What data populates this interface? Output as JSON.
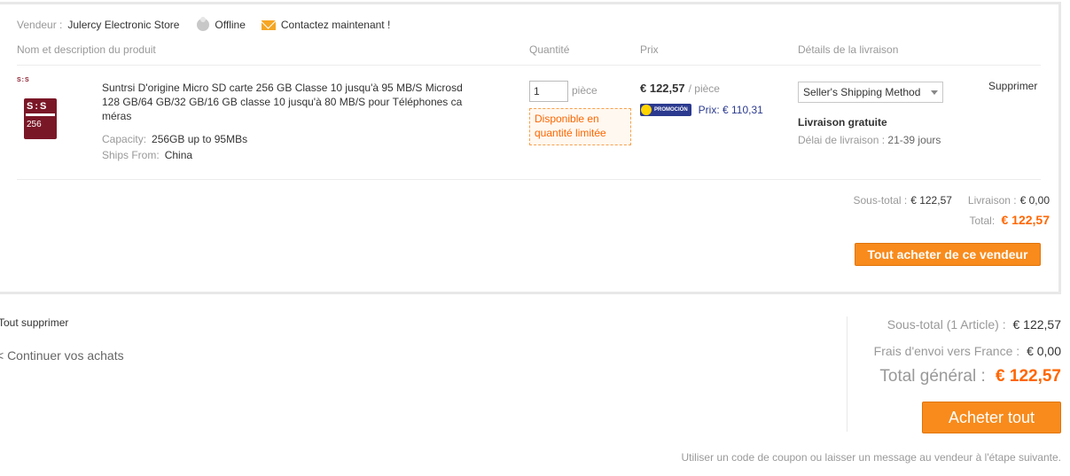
{
  "store": {
    "vendor_label": "Vendeur :",
    "vendor_name": "Julercy Electronic Store",
    "status": "Offline",
    "contact": "Contactez maintenant !"
  },
  "columns": {
    "product": "Nom et description du produit",
    "quantity": "Quantité",
    "price": "Prix",
    "shipping": "Détails de la livraison"
  },
  "item": {
    "thumb_brand": "S:S",
    "thumb_logo": "S:S",
    "thumb_capacity": "256",
    "title": "Suntrsi D'origine Micro SD carte 256 GB Classe 10 jusqu'à 95 MB/S Microsd 128 GB/64 GB/32 GB/16 GB classe 10 jusqu'à 80 MB/S pour Téléphones ca méras",
    "attributes": [
      {
        "label": "Capacity:",
        "value": "256GB up to 95MBs"
      },
      {
        "label": "Ships From:",
        "value": "China"
      }
    ],
    "quantity": "1",
    "quantity_unit": "pièce",
    "stock_warning": "Disponible en quantité limitée",
    "price": "€ 122,57",
    "price_unit": "/ pièce",
    "promo_badge": "PROMOCIÓN",
    "promo_price": "Prix: € 110,31",
    "shipping_method": "Seller's Shipping Method",
    "free_shipping": "Livraison gratuite",
    "delay_label": "Délai de livraison :",
    "delay_value": "21-39 jours",
    "remove": "Supprimer"
  },
  "store_summary": {
    "subtotal_label": "Sous-total :",
    "subtotal": "€ 122,57",
    "shipping_label": "Livraison :",
    "shipping": "€ 0,00",
    "total_label": "Total:",
    "total": "€ 122,57",
    "buy_button": "Tout acheter de ce vendeur"
  },
  "cart_actions": {
    "clear_all": "Tout supprimer",
    "continue": "< Continuer vos achats"
  },
  "cart_summary": {
    "subtotal_label": "Sous-total (1 Article) :",
    "subtotal": "€ 122,57",
    "shipping_label": "Frais d'envoi vers France :",
    "shipping": "€ 0,00",
    "grand_label": "Total général :",
    "grand_total": "€ 122,57",
    "buy_all": "Acheter tout",
    "coupon_note": "Utiliser un code de coupon ou laisser un message au vendeur à l'étape suivante."
  },
  "colors": {
    "accent": "#f88b1c",
    "price_highlight": "#ff6600",
    "promo": "#2b3a8f"
  }
}
